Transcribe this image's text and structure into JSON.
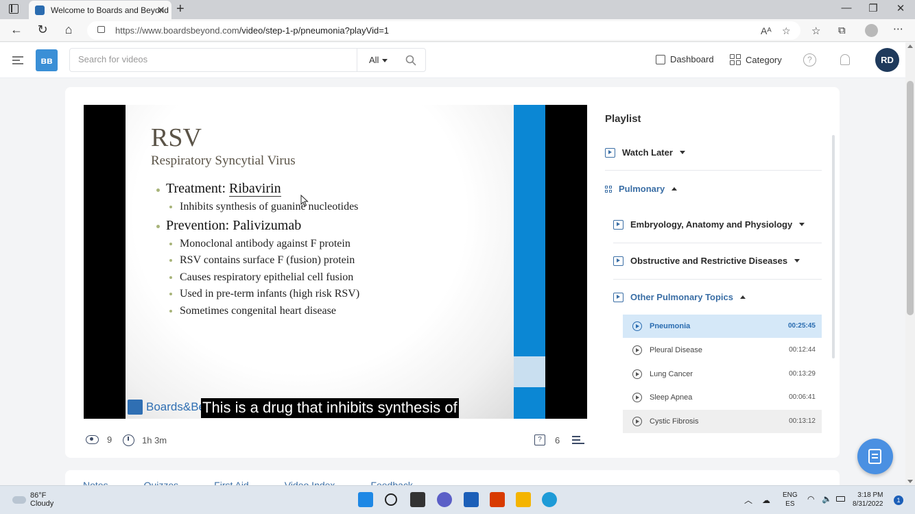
{
  "browser": {
    "tab_title": "Welcome to Boards and Beyond",
    "url_domain": "https://www.boardsbeyond.com",
    "url_path": "/video/step-1-p/pneumonia?playVid=1",
    "read_aloud_label": "Aᴬ"
  },
  "header": {
    "search_placeholder": "Search for videos",
    "search_scope": "All",
    "nav_dashboard": "Dashboard",
    "nav_category": "Category",
    "help_label": "?",
    "avatar_initials": "RD"
  },
  "slide": {
    "title": "RSV",
    "subtitle": "Respiratory Syncytial Virus",
    "bullets": [
      {
        "prefix": "Treatment: ",
        "term": "Ribavirin",
        "subs": [
          "Inhibits synthesis of guanine nucleotides"
        ]
      },
      {
        "prefix": "Prevention: ",
        "term": "Palivizumab",
        "subs": [
          "Monoclonal antibody against F protein",
          "RSV contains surface F (fusion) protein",
          "Causes respiratory epithelial cell fusion",
          "Used in pre-term infants (high risk RSV)",
          "Sometimes congenital heart disease"
        ]
      }
    ],
    "logo_text": "Boards&Be",
    "caption": "This is a drug that inhibits synthesis of"
  },
  "video_stats": {
    "views": "9",
    "duration": "1h 3m",
    "questions": "6"
  },
  "playlist": {
    "title": "Playlist",
    "watch_later": "Watch Later",
    "subject": "Pulmonary",
    "sections": [
      "Embryology, Anatomy and Physiology",
      "Obstructive and Restrictive Diseases",
      "Other Pulmonary Topics"
    ],
    "videos": [
      {
        "title": "Pneumonia",
        "duration": "00:25:45"
      },
      {
        "title": "Pleural Disease",
        "duration": "00:12:44"
      },
      {
        "title": "Lung Cancer",
        "duration": "00:13:29"
      },
      {
        "title": "Sleep Apnea",
        "duration": "00:06:41"
      },
      {
        "title": "Cystic Fibrosis",
        "duration": "00:13:12"
      }
    ]
  },
  "lower_tabs": [
    "Notes",
    "Quizzes",
    "First Aid",
    "Video Index",
    "Feedback"
  ],
  "taskbar": {
    "temperature": "86°F",
    "condition": "Cloudy",
    "lang1": "ENG",
    "lang2": "ES",
    "time": "3:18 PM",
    "date": "8/31/2022",
    "notifications": "1"
  }
}
